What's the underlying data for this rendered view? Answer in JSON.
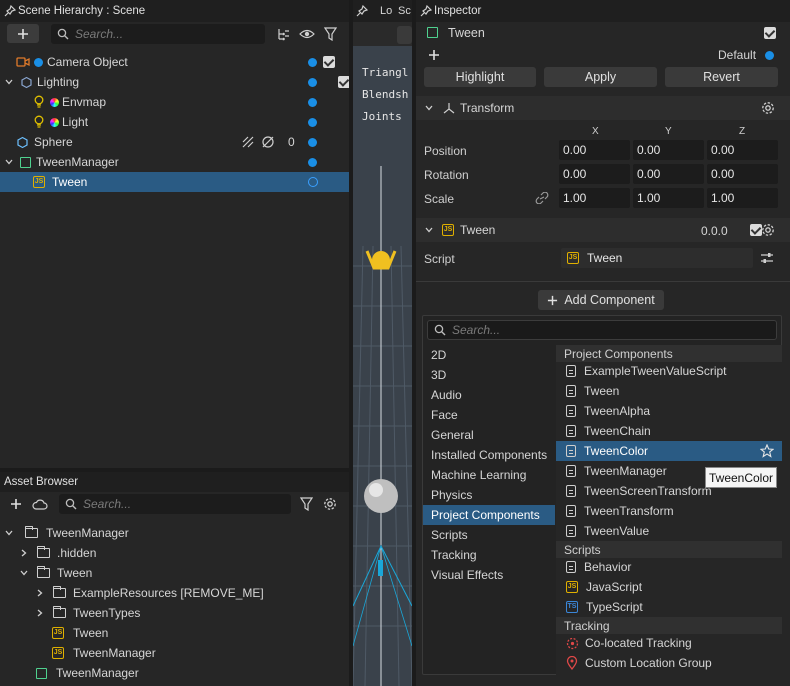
{
  "hierarchy": {
    "title": "Scene Hierarchy : Scene",
    "search_placeholder": "Search...",
    "items": [
      {
        "label": "Camera Object"
      },
      {
        "label": "Lighting"
      },
      {
        "label": "Envmap"
      },
      {
        "label": "Light"
      },
      {
        "label": "Sphere",
        "count": "0"
      },
      {
        "label": "TweenManager"
      },
      {
        "label": "Tween"
      }
    ]
  },
  "viewport": {
    "tab1": "Lo",
    "tab2": "Sc",
    "stats": [
      "Triangl",
      "Blendsh",
      "Joints"
    ]
  },
  "assets": {
    "title": "Asset Browser",
    "search_placeholder": "Search...",
    "items": [
      {
        "label": "TweenManager"
      },
      {
        "label": ".hidden"
      },
      {
        "label": "Tween"
      },
      {
        "label": "ExampleResources [REMOVE_ME]"
      },
      {
        "label": "TweenTypes"
      },
      {
        "label": "Tween"
      },
      {
        "label": "TweenManager"
      },
      {
        "label": "TweenManager"
      }
    ]
  },
  "inspector": {
    "title": "Inspector",
    "object_name": "Tween",
    "layer": "Default",
    "buttons": {
      "highlight": "Highlight",
      "apply": "Apply",
      "revert": "Revert"
    },
    "transform": {
      "title": "Transform",
      "cols": [
        "X",
        "Y",
        "Z"
      ],
      "rows": [
        {
          "label": "Position",
          "values": [
            "0.00",
            "0.00",
            "0.00"
          ]
        },
        {
          "label": "Rotation",
          "values": [
            "0.00",
            "0.00",
            "0.00"
          ]
        },
        {
          "label": "Scale",
          "values": [
            "1.00",
            "1.00",
            "1.00"
          ]
        }
      ]
    },
    "script_component": {
      "title": "Tween",
      "version": "0.0.0",
      "script_label": "Script",
      "script_value": "Tween"
    },
    "add_component": {
      "label": "Add Component",
      "search_placeholder": "Search...",
      "categories": [
        "2D",
        "3D",
        "Audio",
        "Face",
        "General",
        "Installed Components",
        "Machine Learning",
        "Physics",
        "Project Components",
        "Scripts",
        "Tracking",
        "Visual Effects"
      ],
      "groups": {
        "project": "Project Components",
        "scripts": "Scripts",
        "tracking": "Tracking"
      },
      "project_items": [
        "ExampleTweenValueScript",
        "Tween",
        "TweenAlpha",
        "TweenChain",
        "TweenColor",
        "TweenManager",
        "TweenScreenTransform",
        "TweenTransform",
        "TweenValue"
      ],
      "script_items": [
        "Behavior",
        "JavaScript",
        "TypeScript"
      ],
      "tracking_items": [
        "Co-located Tracking",
        "Custom Location Group"
      ],
      "tooltip": "TweenColor"
    }
  },
  "colors": {
    "accent": "#1a8fe6",
    "selection": "#2a5b84",
    "js": "#e0b000"
  }
}
